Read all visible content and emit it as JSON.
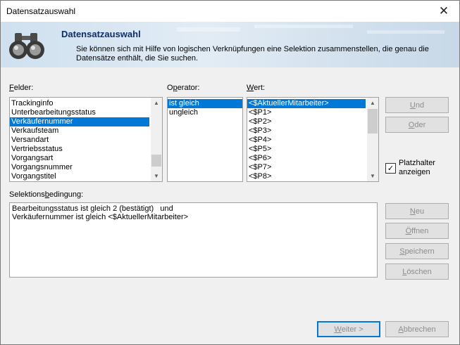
{
  "window": {
    "title": "Datensatzauswahl",
    "close_glyph": "✕"
  },
  "banner": {
    "heading": "Datensatzauswahl",
    "description": "Sie können sich mit Hilfe von logischen Verknüpfungen eine Selektion zusammenstellen, die genau die Datensätze enthält, die Sie suchen.",
    "icon": "binoculars-icon"
  },
  "labels": {
    "felder_pre": "",
    "felder_u": "F",
    "felder_post": "elder:",
    "operator_pre": "O",
    "operator_u": "p",
    "operator_post": "erator:",
    "wert_pre": "",
    "wert_u": "W",
    "wert_post": "ert:",
    "selektion_pre": "Selektions",
    "selektion_u": "b",
    "selektion_post": "edingung:"
  },
  "felder": {
    "items": [
      "Trackinginfo",
      "Unterbearbeitungsstatus",
      "Verkäufernummer",
      "Verkaufsteam",
      "Versandart",
      "Vertriebsstatus",
      "Vorgangsart",
      "Vorgangsnummer",
      "Vorgangstitel"
    ],
    "selected_index": 2
  },
  "operator": {
    "items": [
      "ist gleich",
      "ungleich"
    ],
    "selected_index": 0
  },
  "wert": {
    "items": [
      "<$AktuellerMitarbeiter>",
      "<$P1>",
      "<$P2>",
      "<$P3>",
      "<$P4>",
      "<$P5>",
      "<$P6>",
      "<$P7>",
      "<$P8>"
    ],
    "selected_index": 0
  },
  "buttons": {
    "und_u": "U",
    "und_post": "nd",
    "oder_u": "O",
    "oder_post": "der",
    "neu_u": "N",
    "neu_post": "eu",
    "oeffnen_u": "Ö",
    "oeffnen_post": "ffnen",
    "speichern_u": "S",
    "speichern_post": "peichern",
    "loeschen_u": "L",
    "loeschen_post": "öschen",
    "weiter_u": "W",
    "weiter_post": "eiter >",
    "abbrechen_u": "A",
    "abbrechen_post": "bbrechen"
  },
  "platzhalter": {
    "label_line1": "Platzhalter",
    "label_line2": "anzeigen",
    "checked": true,
    "check_glyph": "✓"
  },
  "selektion": {
    "text": "Bearbeitungsstatus ist gleich 2 (bestätigt)   und\nVerkäufernummer ist gleich <$AktuellerMitarbeiter>"
  },
  "colors": {
    "selection": "#0078d7",
    "heading": "#0b2f6a",
    "disabled_text": "#8d8d8d"
  }
}
